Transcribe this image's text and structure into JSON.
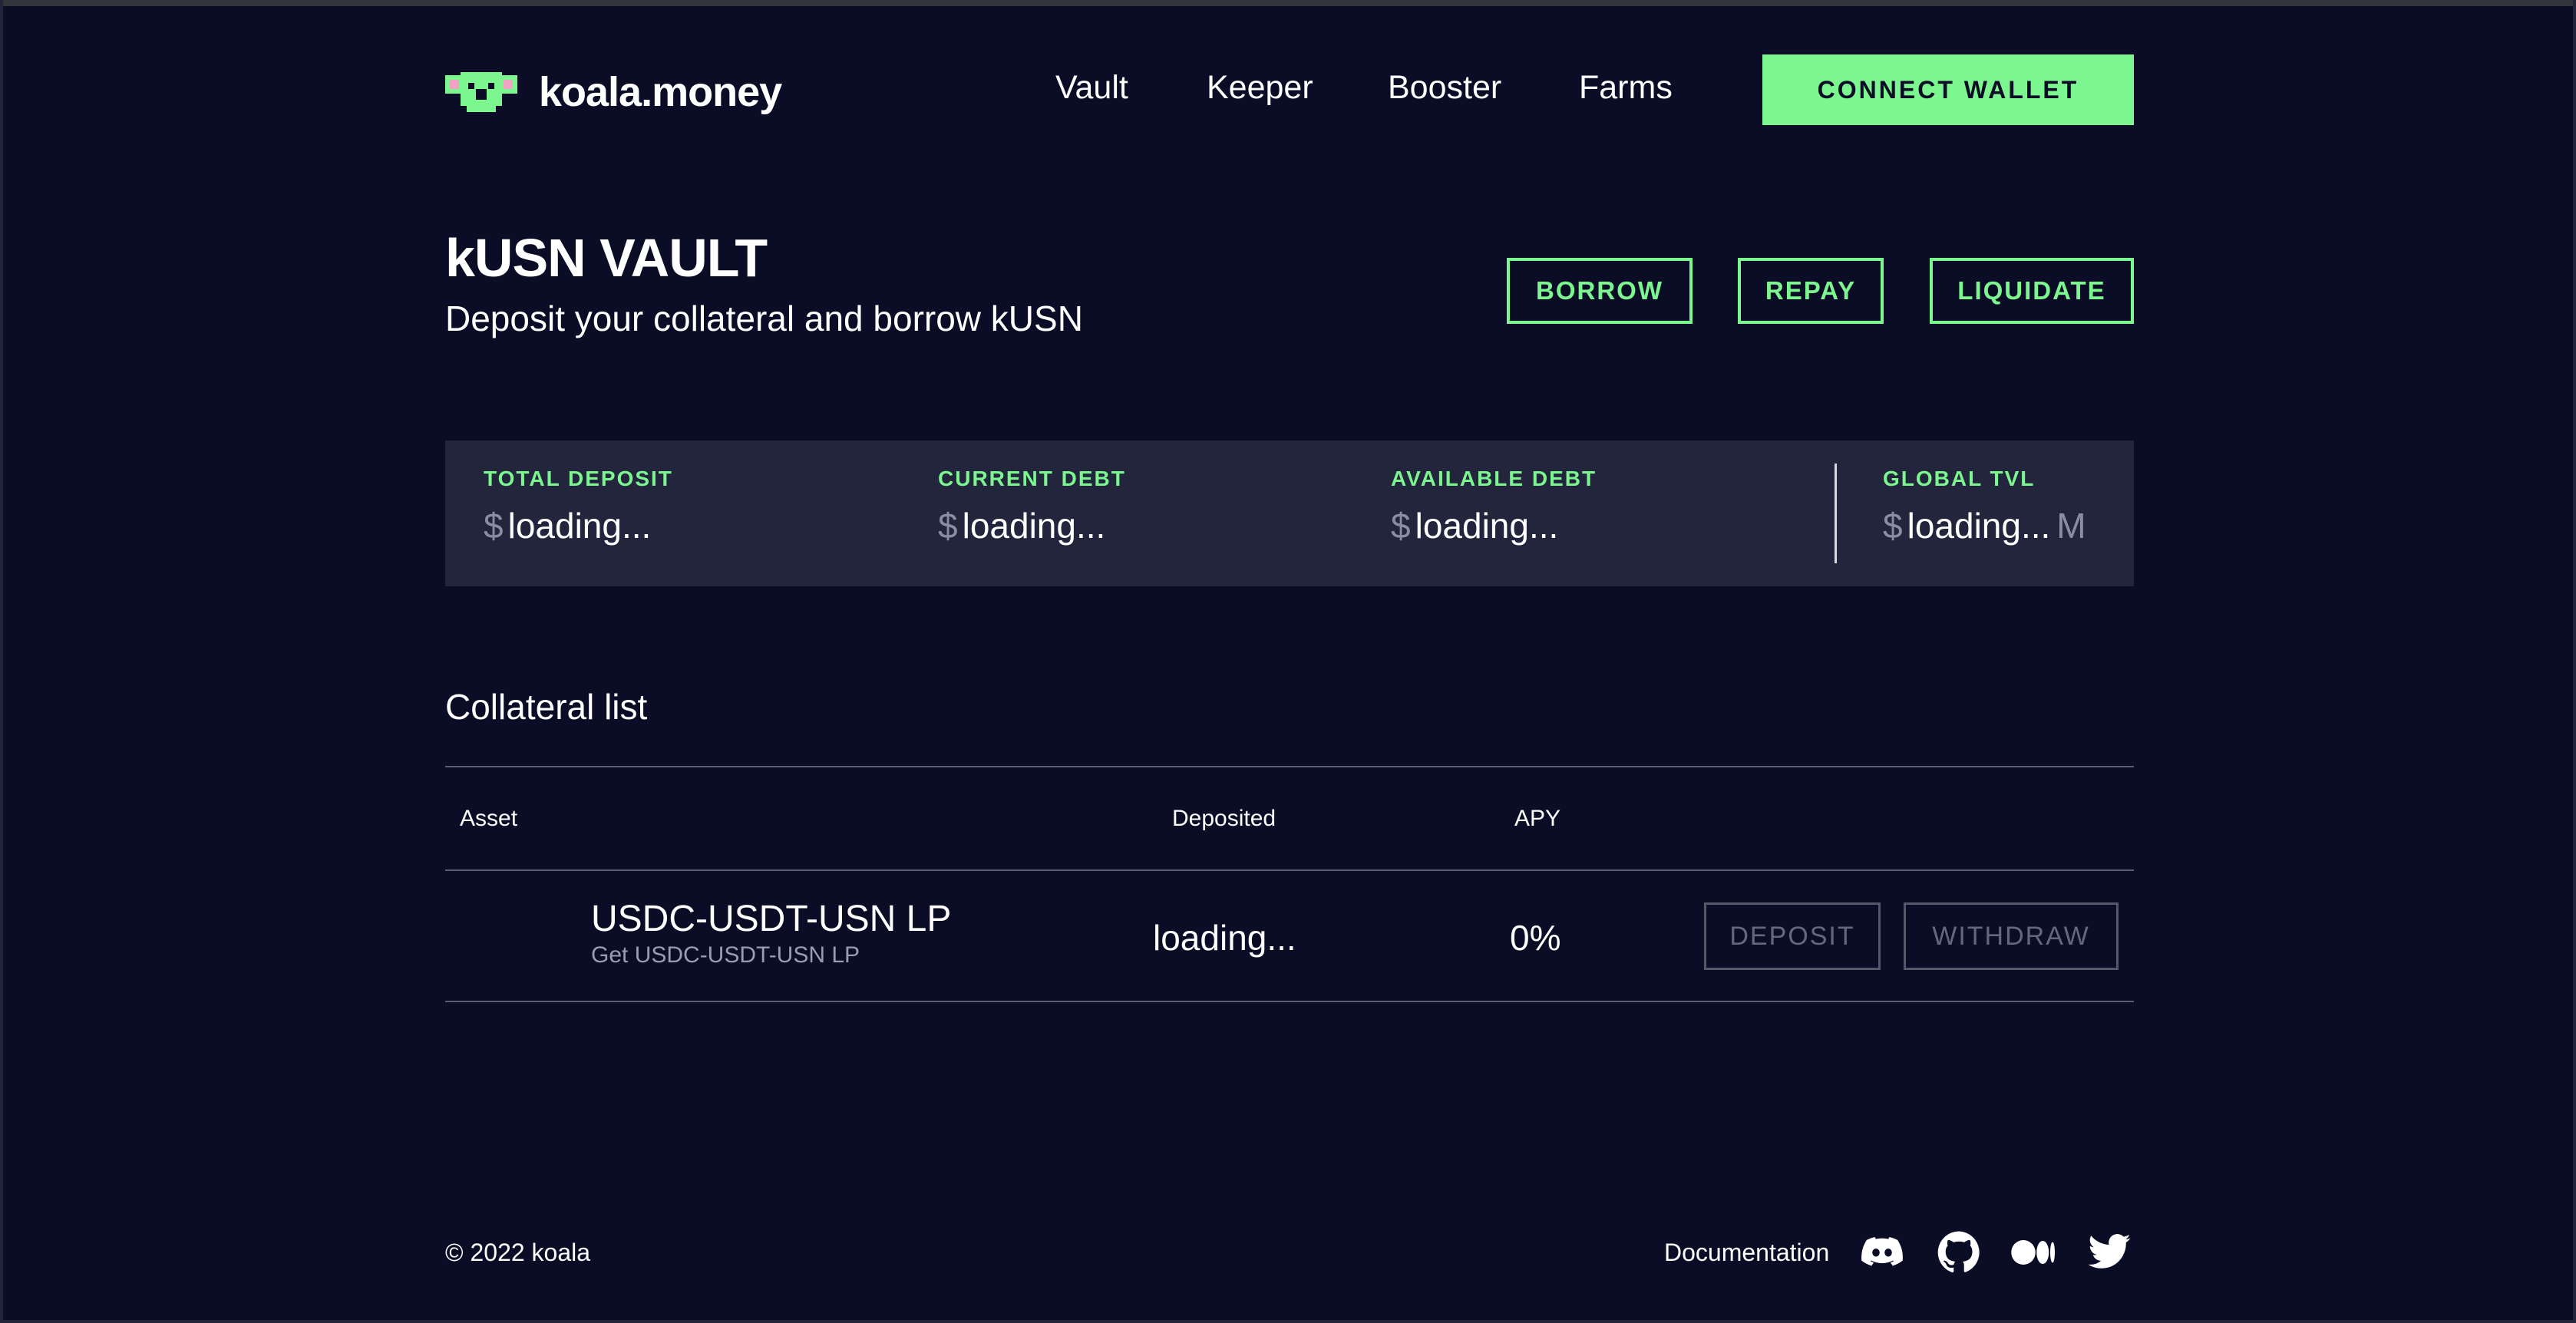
{
  "brand": {
    "name": "koala.money"
  },
  "nav": {
    "items": [
      "Vault",
      "Keeper",
      "Booster",
      "Farms"
    ],
    "connect_label": "CONNECT WALLET"
  },
  "vault": {
    "title": "kUSN VAULT",
    "subtitle": "Deposit your collateral and borrow kUSN",
    "actions": [
      "BORROW",
      "REPAY",
      "LIQUIDATE"
    ]
  },
  "stats": {
    "currency": "$",
    "items": [
      {
        "label": "TOTAL DEPOSIT",
        "value": "loading..."
      },
      {
        "label": "CURRENT DEBT",
        "value": "loading..."
      },
      {
        "label": "AVAILABLE DEBT",
        "value": "loading..."
      },
      {
        "label": "GLOBAL TVL",
        "value": "loading...",
        "unit": "M"
      }
    ]
  },
  "collateral": {
    "title": "Collateral list",
    "headers": {
      "asset": "Asset",
      "deposited": "Deposited",
      "apy": "APY"
    },
    "rows": [
      {
        "name": "USDC-USDT-USN LP",
        "sub": "Get USDC-USDT-USN LP",
        "deposited": "loading...",
        "apy": "0%",
        "deposit_label": "DEPOSIT",
        "withdraw_label": "WITHDRAW"
      }
    ]
  },
  "footer": {
    "copyright": "© 2022 koala",
    "documentation": "Documentation",
    "socials": [
      "discord-icon",
      "github-icon",
      "medium-icon",
      "twitter-icon"
    ]
  },
  "colors": {
    "background": "#0b0c26",
    "accent": "#7cf78f",
    "panel": "#23253d"
  }
}
